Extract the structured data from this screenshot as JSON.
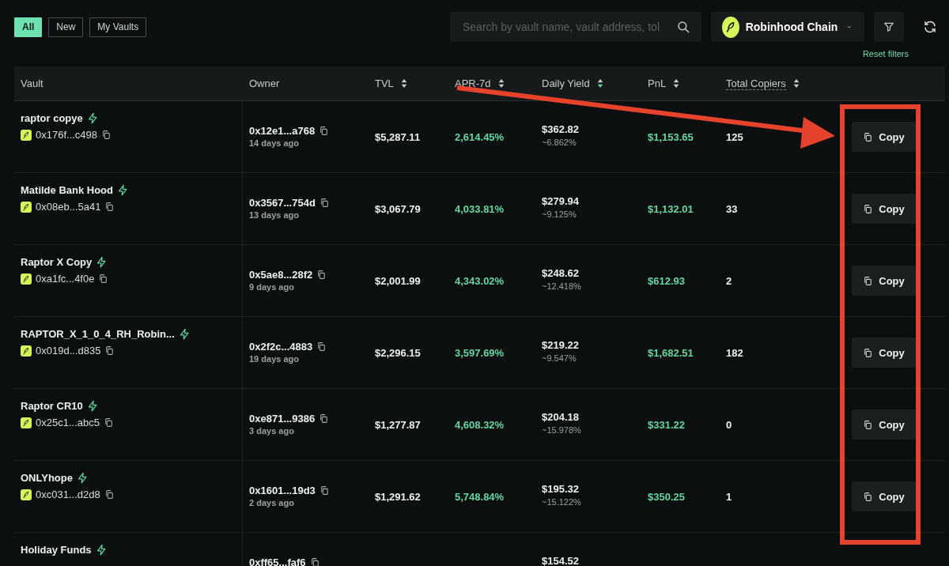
{
  "filters": [
    {
      "label": "All",
      "selected": true
    },
    {
      "label": "New",
      "selected": false
    },
    {
      "label": "My Vaults",
      "selected": false
    }
  ],
  "search": {
    "placeholder": "Search by vault name, vault address, tol"
  },
  "chain": {
    "label": "Robinhood Chain"
  },
  "reset_filters": "Reset filters",
  "table": {
    "columns": [
      {
        "label": "Vault",
        "kind": "plain",
        "underlined": false
      },
      {
        "label": "Owner",
        "kind": "plain",
        "underlined": false
      },
      {
        "label": "TVL",
        "kind": "sortable",
        "sorted": false,
        "underlined": false
      },
      {
        "label": "APR-7d",
        "kind": "sortable",
        "sorted": false,
        "underlined": false
      },
      {
        "label": "Daily Yield",
        "kind": "sortable",
        "sorted": true,
        "underlined": false
      },
      {
        "label": "PnL",
        "kind": "sortable",
        "sorted": false,
        "underlined": false
      },
      {
        "label": "Total Copiers",
        "kind": "sortable",
        "sorted": false,
        "underlined": true
      }
    ],
    "rows": [
      {
        "name": "raptor copye",
        "address": "0x176f...c498",
        "owner": "0x12e1...a768",
        "owner_age": "14 days ago",
        "tvl": "$5,287.11",
        "apr": "2,614.45%",
        "daily_yield": "$362.82",
        "daily_pct": "~6.862%",
        "pnl": "$1,153.65",
        "copiers": "125",
        "action": "Copy"
      },
      {
        "name": "Matilde Bank Hood",
        "address": "0x08eb...5a41",
        "owner": "0x3567...754d",
        "owner_age": "13 days ago",
        "tvl": "$3,067.79",
        "apr": "4,033.81%",
        "daily_yield": "$279.94",
        "daily_pct": "~9.125%",
        "pnl": "$1,132.01",
        "copiers": "33",
        "action": "Copy"
      },
      {
        "name": "Raptor X Copy",
        "address": "0xa1fc...4f0e",
        "owner": "0x5ae8...28f2",
        "owner_age": "9 days ago",
        "tvl": "$2,001.99",
        "apr": "4,343.02%",
        "daily_yield": "$248.62",
        "daily_pct": "~12.418%",
        "pnl": "$612.93",
        "copiers": "2",
        "action": "Copy"
      },
      {
        "name": "RAPTOR_X_1_0_4_RH_Robin...",
        "address": "0x019d...d835",
        "owner": "0x2f2c...4883",
        "owner_age": "19 days ago",
        "tvl": "$2,296.15",
        "apr": "3,597.69%",
        "daily_yield": "$219.22",
        "daily_pct": "~9.547%",
        "pnl": "$1,682.51",
        "copiers": "182",
        "action": "Copy"
      },
      {
        "name": "Raptor CR10",
        "address": "0x25c1...abc5",
        "owner": "0xe871...9386",
        "owner_age": "3 days ago",
        "tvl": "$1,277.87",
        "apr": "4,608.32%",
        "daily_yield": "$204.18",
        "daily_pct": "~15.978%",
        "pnl": "$331.22",
        "copiers": "0",
        "action": "Copy"
      },
      {
        "name": "ONLYhope",
        "address": "0xc031...d2d8",
        "owner": "0x1601...19d3",
        "owner_age": "2 days ago",
        "tvl": "$1,291.62",
        "apr": "5,748.84%",
        "daily_yield": "$195.32",
        "daily_pct": "~15.122%",
        "pnl": "$350.25",
        "copiers": "1",
        "action": "Copy"
      },
      {
        "name": "Holiday Funds",
        "owner": "0xff65...faf6",
        "daily_yield": "$154.52"
      }
    ]
  },
  "annotations": {
    "arrow": true,
    "frame": true,
    "color": "#e5432b"
  }
}
